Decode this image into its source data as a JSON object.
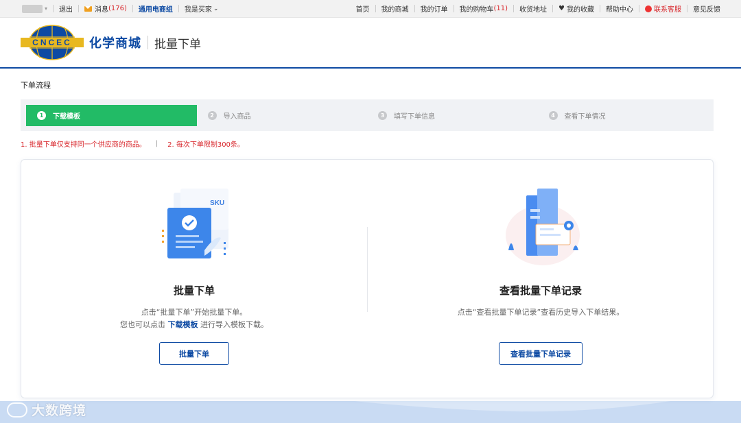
{
  "topbar": {
    "logout": "退出",
    "messages": "消息",
    "messages_count": "(176)",
    "group": "通用电商组",
    "buyer": "我是买家",
    "links": {
      "home": "首页",
      "my_mall": "我的商城",
      "my_orders": "我的订单",
      "cart": "我的购物车",
      "cart_count": "(11)",
      "address": "收货地址",
      "favorites": "我的收藏",
      "help": "帮助中心",
      "support": "联系客服",
      "feedback": "意见反馈"
    }
  },
  "header": {
    "logo_text": "CNCEC",
    "brand": "化学商城",
    "page_title": "批量下单"
  },
  "flow": {
    "title": "下单流程",
    "steps": [
      {
        "num": "1",
        "label": "下载模板"
      },
      {
        "num": "2",
        "label": "导入商品"
      },
      {
        "num": "3",
        "label": "填写下单信息"
      },
      {
        "num": "4",
        "label": "查看下单情况"
      }
    ],
    "notice1": "1. 批量下单仅支持同一个供应商的商品。",
    "notice_sep": "|",
    "notice2": "2. 每次下单限制300条。"
  },
  "left_card": {
    "title": "批量下单",
    "desc1": "点击“批量下单”开始批量下单。",
    "desc2_prefix": "您也可以点击",
    "desc2_link": "下载模板",
    "desc2_suffix": "进行导入模板下载。",
    "button": "批量下单",
    "illus_label": "SKU"
  },
  "right_card": {
    "title": "查看批量下单记录",
    "desc": "点击“查看批量下单记录”查看历史导入下单结果。",
    "button": "查看批量下单记录"
  },
  "watermark": "大数跨境",
  "colors": {
    "brand_blue": "#0d4aa3",
    "step_active": "#22bb66",
    "notice_red": "#d8262b"
  }
}
